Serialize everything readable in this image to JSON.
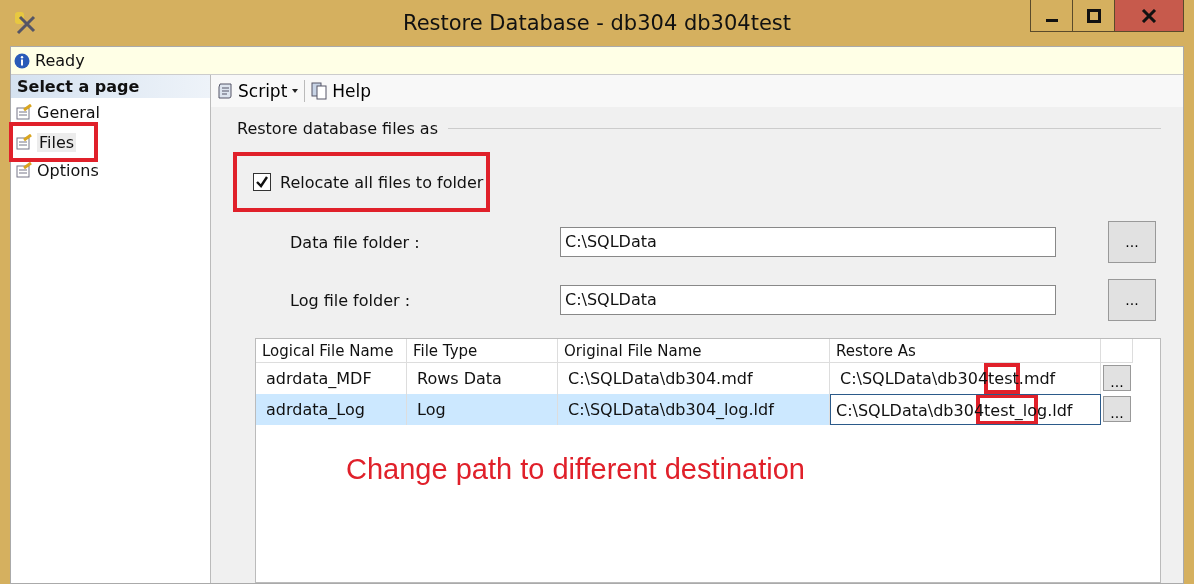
{
  "window": {
    "title": "Restore Database - db304  db304test"
  },
  "status_bar": {
    "text": "Ready"
  },
  "sidebar": {
    "header": "Select a page",
    "items": [
      {
        "label": "General",
        "selected": false,
        "highlighted": false
      },
      {
        "label": "Files",
        "selected": true,
        "highlighted": true
      },
      {
        "label": "Options",
        "selected": false,
        "highlighted": false
      }
    ]
  },
  "toolbar": {
    "items": [
      {
        "label": "Script",
        "kind": "dropdown"
      },
      {
        "label": "Help",
        "kind": "button"
      }
    ]
  },
  "section": {
    "title": "Restore database files as"
  },
  "relocate": {
    "label": "Relocate all files to folder",
    "checked": true,
    "highlighted": true
  },
  "folders": [
    {
      "label": "Data file folder :",
      "value": "C:\\SQLData",
      "browse": "..."
    },
    {
      "label": "Log file folder :",
      "value": "C:\\SQLData",
      "browse": "..."
    }
  ],
  "table": {
    "columns": [
      "Logical File Name",
      "File Type",
      "Original File Name",
      "Restore As"
    ],
    "rows": [
      {
        "cells": [
          "adrdata_MDF",
          "Rows Data",
          "C:\\SQLData\\db304.mdf",
          "C:\\SQLData\\db304test.mdf"
        ],
        "browse": "...",
        "selected": false,
        "editing": false,
        "highlighted": true
      },
      {
        "cells": [
          "adrdata_Log",
          "Log",
          "C:\\SQLData\\db304_log.ldf",
          "C:\\SQLData\\db304test_log.ldf"
        ],
        "browse": "...",
        "selected": true,
        "editing": true,
        "highlighted": true
      }
    ]
  },
  "annotation": {
    "text": "Change path to different destination"
  }
}
